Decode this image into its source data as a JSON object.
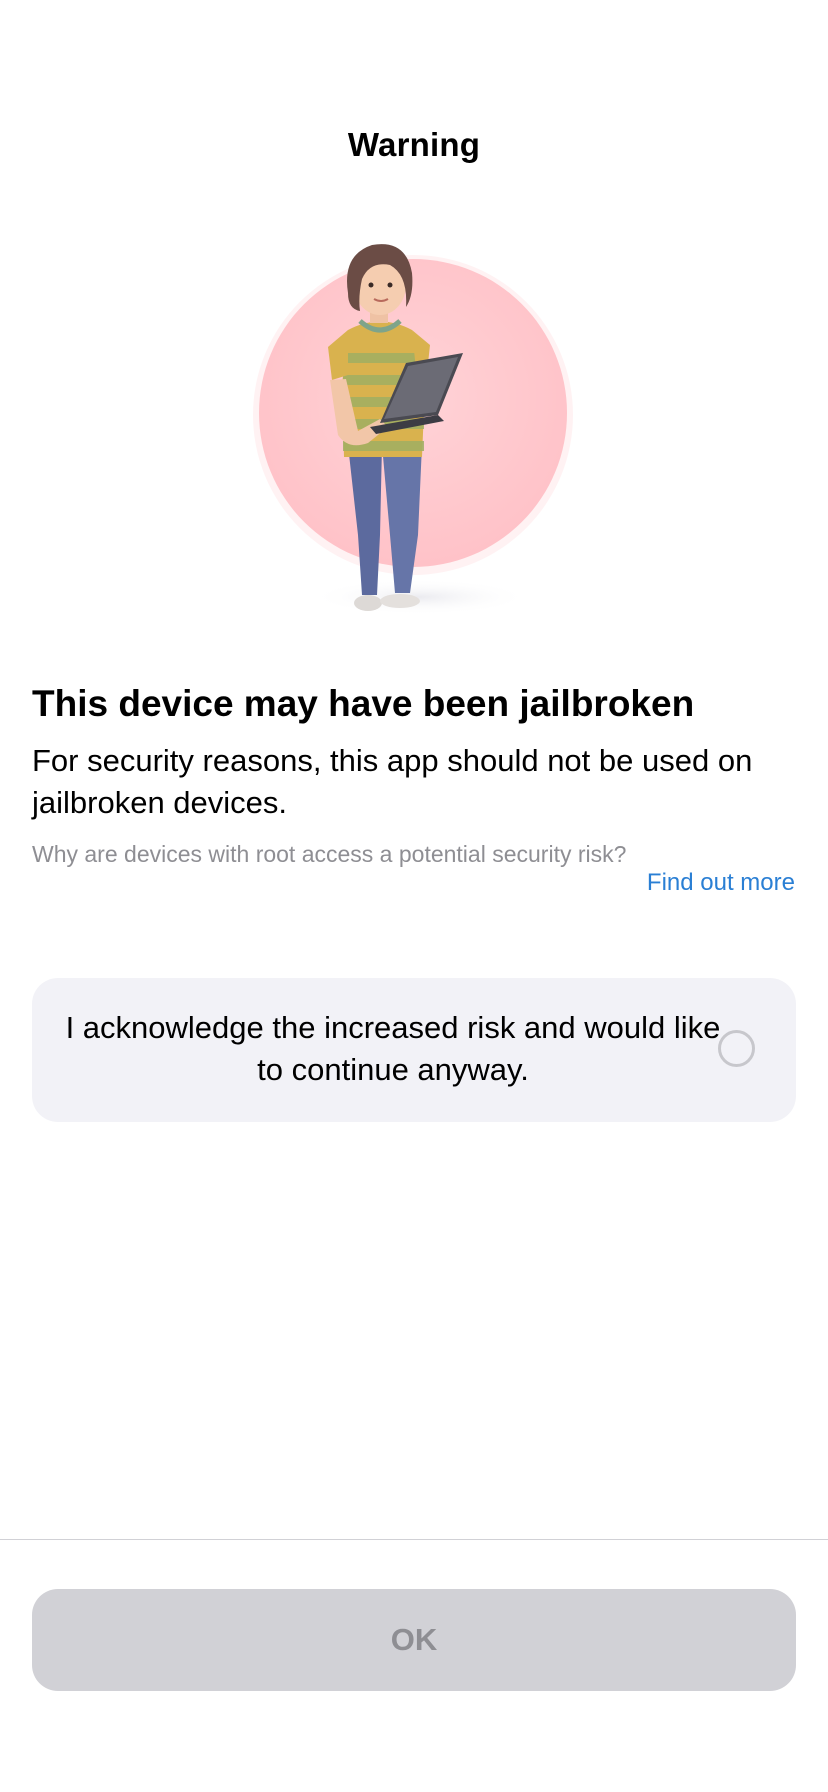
{
  "nav": {
    "title": "Warning"
  },
  "illustration": {
    "icon": "woman-with-laptop-illustration",
    "circle_color": "#ffcdd2"
  },
  "content": {
    "headline": "This device may have been jailbroken",
    "body": "For security reasons, this app should not be used on jailbroken devices.",
    "question": "Why are devices with root access a potential security risk?",
    "link_label": "Find out more"
  },
  "acknowledge": {
    "label": "I acknowledge the increased risk and would like to continue anyway.",
    "checked": false
  },
  "footer": {
    "ok_label": "OK",
    "ok_enabled": false
  },
  "colors": {
    "link": "#2a7fd4",
    "secondary_text": "#8e8e93",
    "card_background": "#f2f2f7",
    "button_disabled": "#d1d1d6"
  }
}
